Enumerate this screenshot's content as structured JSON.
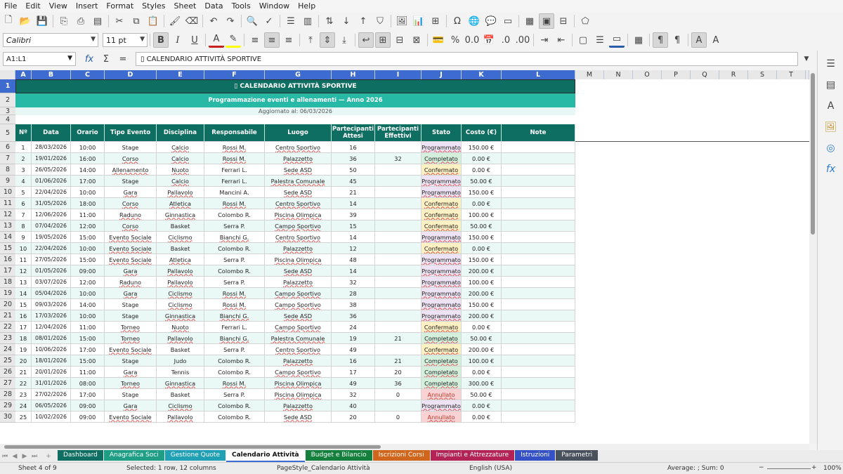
{
  "menu": [
    "File",
    "Edit",
    "View",
    "Insert",
    "Format",
    "Styles",
    "Sheet",
    "Data",
    "Tools",
    "Window",
    "Help"
  ],
  "toolbar": {
    "font_name": "Calibri",
    "font_size": "11 pt",
    "bold_label": "B",
    "italic_label": "I",
    "underline_label": "U",
    "font_color": "#c9211e",
    "highlight_color": "#ffff00"
  },
  "formula_bar": {
    "cell_ref": "A1:L1",
    "content": "▯ CALENDARIO ATTIVITÀ SPORTIVE",
    "fx": "fx",
    "sigma": "Σ",
    "equals": "="
  },
  "columns": [
    {
      "label": "A",
      "sel": true
    },
    {
      "label": "B",
      "sel": true
    },
    {
      "label": "C",
      "sel": true
    },
    {
      "label": "D",
      "sel": true
    },
    {
      "label": "E",
      "sel": true
    },
    {
      "label": "F",
      "sel": true
    },
    {
      "label": "G",
      "sel": true
    },
    {
      "label": "H",
      "sel": true
    },
    {
      "label": "I",
      "sel": true
    },
    {
      "label": "J",
      "sel": true
    },
    {
      "label": "K",
      "sel": true
    },
    {
      "label": "L",
      "sel": true
    },
    {
      "label": "M",
      "sel": false
    },
    {
      "label": "N",
      "sel": false
    },
    {
      "label": "O",
      "sel": false
    },
    {
      "label": "P",
      "sel": false
    },
    {
      "label": "Q",
      "sel": false
    },
    {
      "label": "R",
      "sel": false
    },
    {
      "label": "S",
      "sel": false
    },
    {
      "label": "T",
      "sel": false
    }
  ],
  "sheet": {
    "title": "▯ CALENDARIO ATTIVITÀ SPORTIVE",
    "subtitle": "Programmazione eventi e allenamenti — Anno 2026",
    "updated": "Aggiornato al: 06/03/2026",
    "headers": [
      "Nº",
      "Data",
      "Orario",
      "Tipo Evento",
      "Disciplina",
      "Responsabile",
      "Luogo",
      "Partecipanti Attesi",
      "Partecipanti Effettivi",
      "Stato",
      "Costo (€)",
      "Note"
    ],
    "rows": [
      {
        "r": "6",
        "cells": [
          "1",
          "28/03/2026",
          "10:00",
          "Stage",
          "Calcio",
          "Rossi M.",
          "Centro Sportivo",
          "16",
          "",
          "Programmato",
          "150.00 €",
          ""
        ]
      },
      {
        "r": "7",
        "cells": [
          "2",
          "19/01/2026",
          "16:00",
          "Corso",
          "Calcio",
          "Rossi M.",
          "Palazzetto",
          "36",
          "32",
          "Completato",
          "0.00 €",
          ""
        ]
      },
      {
        "r": "8",
        "cells": [
          "3",
          "26/05/2026",
          "14:00",
          "Allenamento",
          "Nuoto",
          "Ferrari L.",
          "Sede ASD",
          "50",
          "",
          "Confermato",
          "0.00 €",
          ""
        ]
      },
      {
        "r": "9",
        "cells": [
          "4",
          "01/06/2026",
          "17:00",
          "Stage",
          "Calcio",
          "Ferrari L.",
          "Palestra Comunale",
          "45",
          "",
          "Programmato",
          "50.00 €",
          ""
        ]
      },
      {
        "r": "10",
        "cells": [
          "5",
          "22/04/2026",
          "10:00",
          "Gara",
          "Pallavolo",
          "Mancini A.",
          "Sede ASD",
          "21",
          "",
          "Programmato",
          "150.00 €",
          ""
        ]
      },
      {
        "r": "11",
        "cells": [
          "6",
          "31/05/2026",
          "18:00",
          "Corso",
          "Atletica",
          "Rossi M.",
          "Centro Sportivo",
          "14",
          "",
          "Confermato",
          "0.00 €",
          ""
        ]
      },
      {
        "r": "12",
        "cells": [
          "7",
          "12/06/2026",
          "11:00",
          "Raduno",
          "Ginnastica",
          "Colombo R.",
          "Piscina Olimpica",
          "39",
          "",
          "Confermato",
          "100.00 €",
          ""
        ]
      },
      {
        "r": "13",
        "cells": [
          "8",
          "07/04/2026",
          "12:00",
          "Corso",
          "Basket",
          "Serra P.",
          "Campo Sportivo",
          "15",
          "",
          "Confermato",
          "50.00 €",
          ""
        ]
      },
      {
        "r": "14",
        "cells": [
          "9",
          "19/05/2026",
          "15:00",
          "Evento Sociale",
          "Ciclismo",
          "Bianchi G.",
          "Centro Sportivo",
          "14",
          "",
          "Programmato",
          "150.00 €",
          ""
        ]
      },
      {
        "r": "15",
        "cells": [
          "10",
          "22/04/2026",
          "10:00",
          "Evento Sociale",
          "Basket",
          "Colombo R.",
          "Palazzetto",
          "12",
          "",
          "Confermato",
          "0.00 €",
          ""
        ]
      },
      {
        "r": "16",
        "cells": [
          "11",
          "27/05/2026",
          "15:00",
          "Evento Sociale",
          "Atletica",
          "Serra P.",
          "Piscina Olimpica",
          "48",
          "",
          "Programmato",
          "150.00 €",
          ""
        ]
      },
      {
        "r": "17",
        "cells": [
          "12",
          "01/05/2026",
          "09:00",
          "Gara",
          "Pallavolo",
          "Colombo R.",
          "Sede ASD",
          "14",
          "",
          "Programmato",
          "200.00 €",
          ""
        ]
      },
      {
        "r": "18",
        "cells": [
          "13",
          "03/07/2026",
          "12:00",
          "Raduno",
          "Pallavolo",
          "Serra P.",
          "Palazzetto",
          "32",
          "",
          "Programmato",
          "100.00 €",
          ""
        ]
      },
      {
        "r": "19",
        "cells": [
          "14",
          "05/04/2026",
          "10:00",
          "Gara",
          "Ciclismo",
          "Rossi M.",
          "Campo Sportivo",
          "28",
          "",
          "Programmato",
          "200.00 €",
          ""
        ]
      },
      {
        "r": "20",
        "cells": [
          "15",
          "09/03/2026",
          "14:00",
          "Stage",
          "Ciclismo",
          "Rossi M.",
          "Campo Sportivo",
          "38",
          "",
          "Programmato",
          "150.00 €",
          ""
        ]
      },
      {
        "r": "21",
        "cells": [
          "16",
          "17/03/2026",
          "10:00",
          "Stage",
          "Ginnastica",
          "Bianchi G.",
          "Sede ASD",
          "36",
          "",
          "Programmato",
          "200.00 €",
          ""
        ]
      },
      {
        "r": "22",
        "cells": [
          "17",
          "12/04/2026",
          "11:00",
          "Torneo",
          "Nuoto",
          "Ferrari L.",
          "Campo Sportivo",
          "24",
          "",
          "Confermato",
          "0.00 €",
          ""
        ]
      },
      {
        "r": "23",
        "cells": [
          "18",
          "08/01/2026",
          "15:00",
          "Torneo",
          "Pallavolo",
          "Bianchi G.",
          "Palestra Comunale",
          "19",
          "21",
          "Completato",
          "50.00 €",
          ""
        ]
      },
      {
        "r": "24",
        "cells": [
          "19",
          "10/06/2026",
          "17:00",
          "Evento Sociale",
          "Basket",
          "Serra P.",
          "Centro Sportivo",
          "49",
          "",
          "Confermato",
          "200.00 €",
          ""
        ]
      },
      {
        "r": "25",
        "cells": [
          "20",
          "18/01/2026",
          "15:00",
          "Stage",
          "Judo",
          "Colombo R.",
          "Palazzetto",
          "16",
          "21",
          "Completato",
          "100.00 €",
          ""
        ]
      },
      {
        "r": "26",
        "cells": [
          "21",
          "20/01/2026",
          "11:00",
          "Gara",
          "Tennis",
          "Colombo R.",
          "Campo Sportivo",
          "17",
          "20",
          "Completato",
          "0.00 €",
          ""
        ]
      },
      {
        "r": "27",
        "cells": [
          "22",
          "31/01/2026",
          "08:00",
          "Torneo",
          "Ginnastica",
          "Rossi M.",
          "Piscina Olimpica",
          "49",
          "36",
          "Completato",
          "300.00 €",
          ""
        ]
      },
      {
        "r": "28",
        "cells": [
          "23",
          "27/02/2026",
          "17:00",
          "Stage",
          "Basket",
          "Serra P.",
          "Piscina Olimpica",
          "32",
          "0",
          "Annullato",
          "50.00 €",
          ""
        ]
      },
      {
        "r": "29",
        "cells": [
          "24",
          "06/05/2026",
          "09:00",
          "Gara",
          "Ciclismo",
          "Colombo R.",
          "Palazzetto",
          "40",
          "",
          "Programmato",
          "0.00 €",
          ""
        ]
      },
      {
        "r": "30",
        "cells": [
          "25",
          "10/02/2026",
          "09:00",
          "Evento Sociale",
          "Pallavolo",
          "Colombo R.",
          "Sede ASD",
          "20",
          "0",
          "Annullato",
          "0.00 €",
          ""
        ]
      }
    ]
  },
  "status_colors": {
    "Programmato": "#ede3f5",
    "Completato": "#d4f0dc",
    "Confermato": "#fdf0c2",
    "Annullato": "#f9d3d3"
  },
  "colors": {
    "header": "#0e6e61",
    "subheader": "#27b8a6",
    "row_alt": "#eaf8f6",
    "selection": "#3e6bd0"
  },
  "tabs": [
    {
      "label": "Dashboard",
      "color": "#0e6e61"
    },
    {
      "label": "Anagrafica Soci",
      "color": "#1e9e85"
    },
    {
      "label": "Gestione Quote",
      "color": "#1fa0b5"
    },
    {
      "label": "Calendario Attività",
      "color": "#ffffff",
      "active": true
    },
    {
      "label": "Budget e Bilancio",
      "color": "#157f3e"
    },
    {
      "label": "Iscrizioni Corsi",
      "color": "#d0661b"
    },
    {
      "label": "Impianti e Attrezzature",
      "color": "#b32356"
    },
    {
      "label": "Istruzioni",
      "color": "#3451c6"
    },
    {
      "label": "Parametri",
      "color": "#48515c"
    }
  ],
  "status_bar": {
    "sheet": "Sheet 4 of 9",
    "selected": "Selected: 1 row, 12 columns",
    "page_style": "PageStyle_Calendario Attività",
    "language": "English (USA)",
    "summary": "Average: ; Sum: 0",
    "zoom": "100%"
  }
}
